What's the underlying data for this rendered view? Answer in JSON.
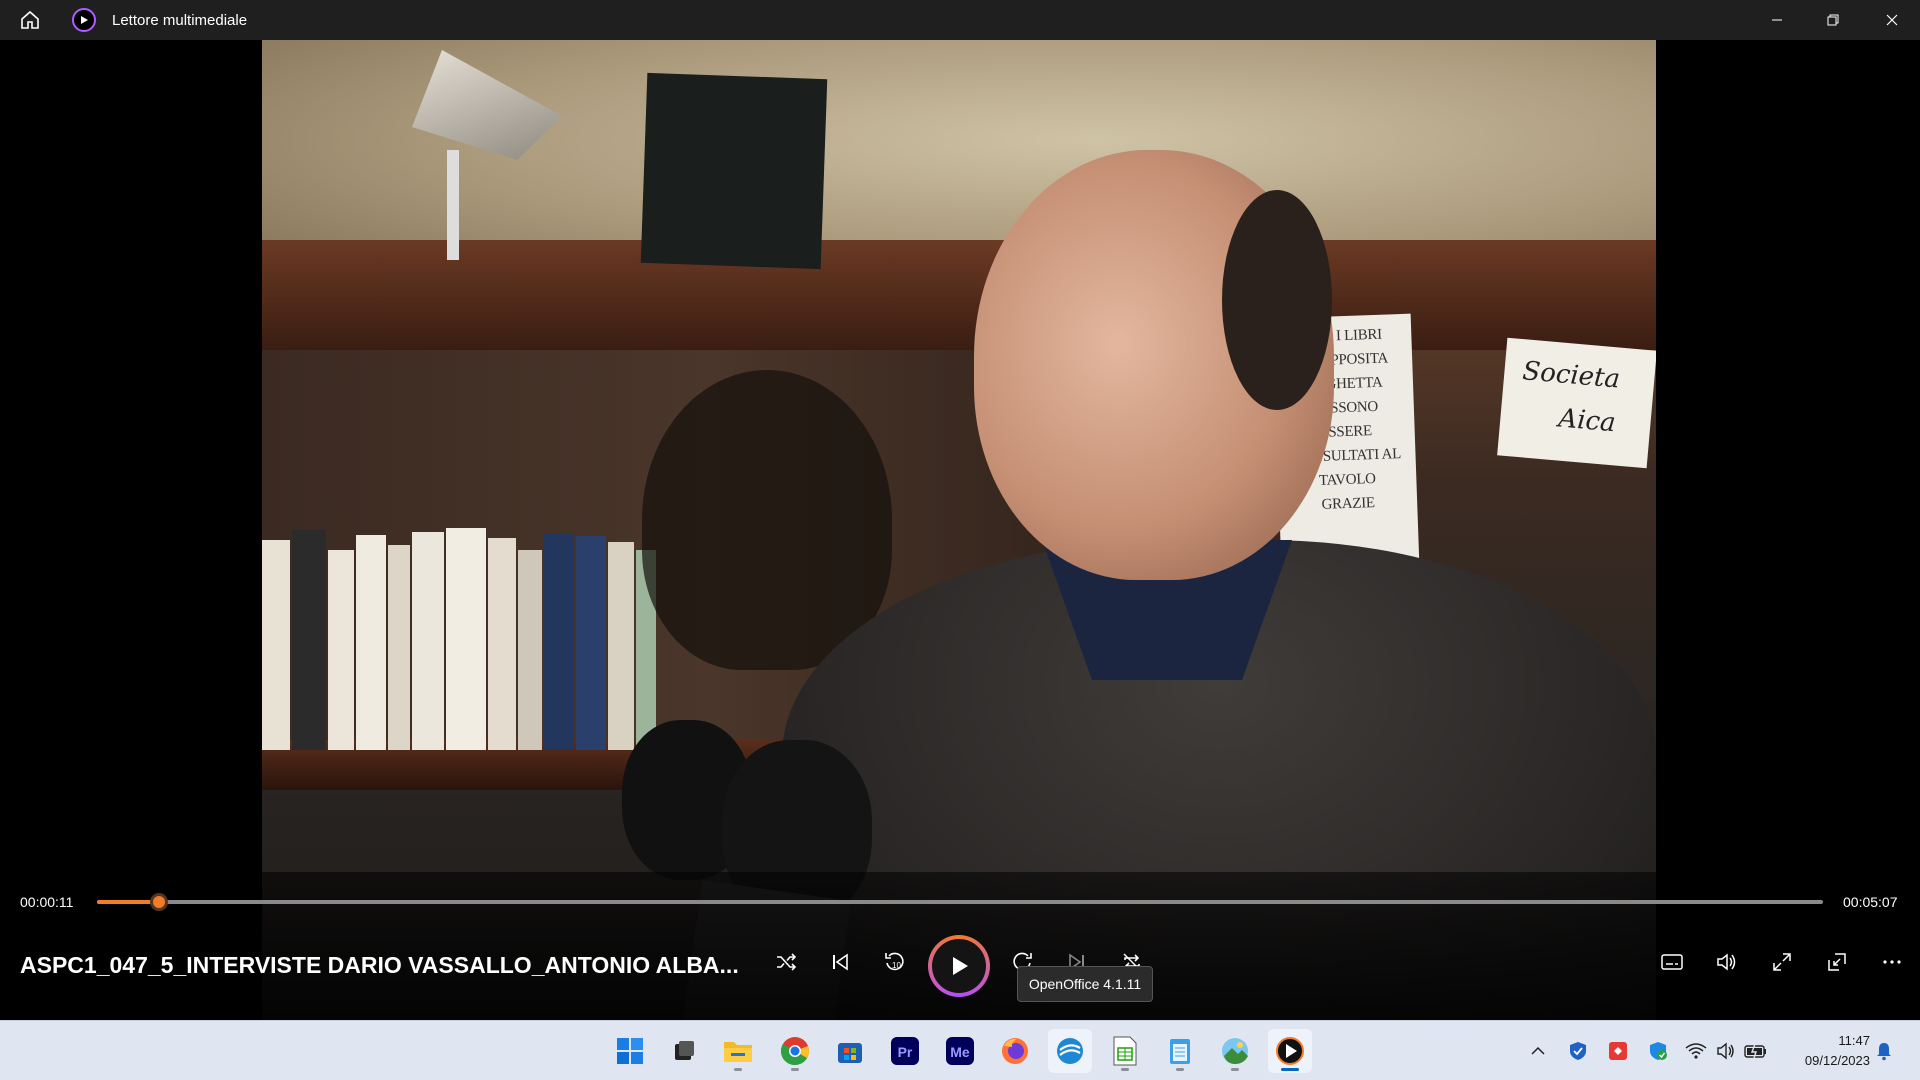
{
  "window": {
    "app_title": "Lettore multimediale"
  },
  "video": {
    "notice_lines": [
      "...LO I LIBRI",
      "...L'APPOSITA",
      "...RGHETTA",
      "POSSONO",
      "ESSERE",
      "CONSULTATI AL",
      "TAVOLO",
      "GRAZIE"
    ],
    "sign_lines": [
      "Societa",
      "Aica"
    ]
  },
  "player": {
    "current_time": "00:00:11",
    "total_time": "00:05:07",
    "progress": 0.036,
    "media_title": "ASPC1_047_5_INTERVISTE DARIO VASSALLO_ANTONIO ALBA...",
    "tooltip": "OpenOffice 4.1.11",
    "accent_color": "#f27c2a"
  },
  "taskbar": {
    "apps": [
      "start",
      "task-view",
      "file-explorer",
      "chrome",
      "microsoft-store",
      "premiere-pro",
      "media-encoder",
      "firefox",
      "openoffice",
      "libreoffice-calc",
      "notepad",
      "photos",
      "media-player"
    ],
    "clock_time": "11:47",
    "clock_date": "09/12/2023"
  }
}
